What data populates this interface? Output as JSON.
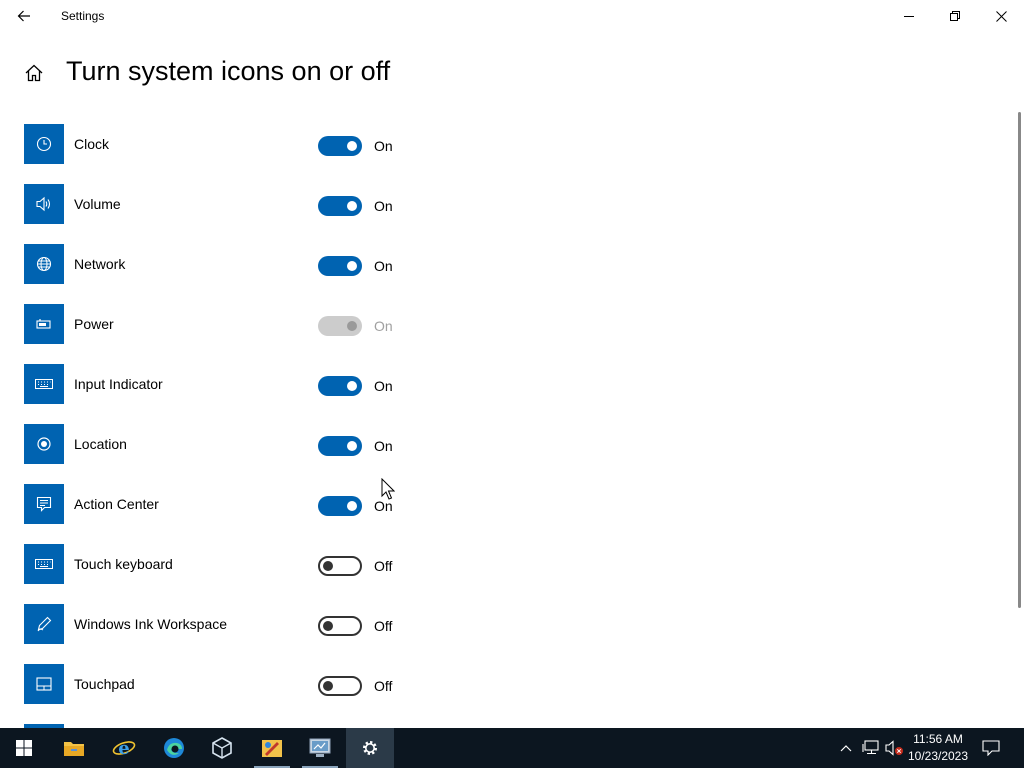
{
  "window": {
    "title": "Settings"
  },
  "page": {
    "title": "Turn system icons on or off"
  },
  "settings": [
    {
      "label": "Clock",
      "state": "On",
      "on": true,
      "disabled": false,
      "icon": "clock-icon"
    },
    {
      "label": "Volume",
      "state": "On",
      "on": true,
      "disabled": false,
      "icon": "volume-icon"
    },
    {
      "label": "Network",
      "state": "On",
      "on": true,
      "disabled": false,
      "icon": "globe-icon"
    },
    {
      "label": "Power",
      "state": "On",
      "on": true,
      "disabled": true,
      "icon": "battery-icon"
    },
    {
      "label": "Input Indicator",
      "state": "On",
      "on": true,
      "disabled": false,
      "icon": "keyboard-icon"
    },
    {
      "label": "Location",
      "state": "On",
      "on": true,
      "disabled": false,
      "icon": "location-icon"
    },
    {
      "label": "Action Center",
      "state": "On",
      "on": true,
      "disabled": false,
      "icon": "action-center-icon"
    },
    {
      "label": "Touch keyboard",
      "state": "Off",
      "on": false,
      "disabled": false,
      "icon": "keyboard-icon"
    },
    {
      "label": "Windows Ink Workspace",
      "state": "Off",
      "on": false,
      "disabled": false,
      "icon": "pen-icon"
    },
    {
      "label": "Touchpad",
      "state": "Off",
      "on": false,
      "disabled": false,
      "icon": "touchpad-icon"
    }
  ],
  "taskbar": {
    "apps": [
      "start-icon",
      "file-explorer-icon",
      "internet-explorer-icon",
      "edge-icon",
      "virtualbox-icon",
      "paint-app-icon",
      "control-panel-icon",
      "settings-gear-icon"
    ],
    "active_app": "settings-gear-icon",
    "time": "11:56 AM",
    "date": "10/23/2023"
  },
  "colors": {
    "accent": "#0063b1",
    "taskbar": "#0c1620"
  }
}
